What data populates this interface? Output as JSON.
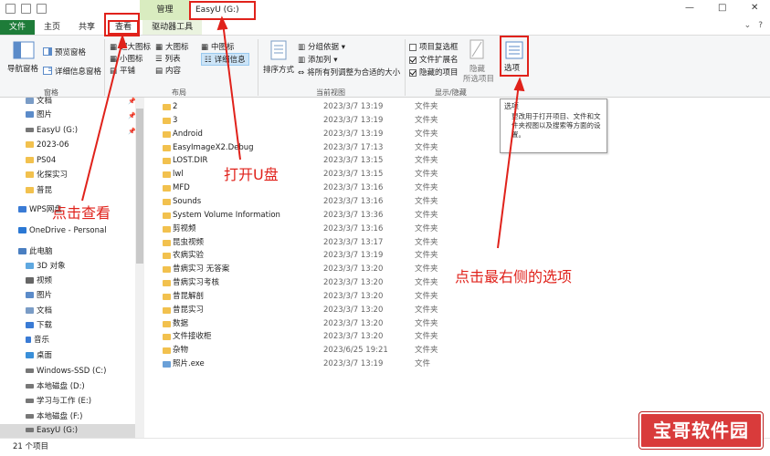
{
  "titlebar": {
    "context_tab": "管理",
    "window_title": "EasyU (G:)",
    "minimize": "—",
    "maximize": "□",
    "close": "✕"
  },
  "tabs": {
    "file": "文件",
    "home": "主页",
    "share": "共享",
    "view": "查看",
    "drive_tools": "驱动器工具",
    "help": "?"
  },
  "ribbon": {
    "nav_pane": "导航窗格",
    "preview_pane": "预览窗格",
    "details_pane": "详细信息窗格",
    "panes_group": "窗格",
    "extra_large_icons": "超大图标",
    "large_icons": "大图标",
    "medium_icons": "中图标",
    "small_icons": "小图标",
    "list": "列表",
    "details": "详细信息",
    "tiles": "平铺",
    "content": "内容",
    "layout_group": "布局",
    "sort_by": "排序方式",
    "group_by": "分组依据",
    "add_columns": "添加列",
    "size_columns": "将所有列调整为合适的大小",
    "current_view_group": "当前视图",
    "item_checkboxes": "项目复选框",
    "file_extensions": "文件扩展名",
    "hidden_items": "隐藏的项目",
    "hide_selected_1": "隐藏",
    "hide_selected_2": "所选项目",
    "options": "选项",
    "show_hide_group": "显示/隐藏"
  },
  "tooltip": {
    "title": "选项",
    "body": "更改用于打开项目、文件和文件夹视图以及搜索等方面的设置。"
  },
  "nav": [
    {
      "label": "文档",
      "pinned": true
    },
    {
      "label": "图片",
      "pinned": true
    },
    {
      "label": "EasyU (G:)",
      "pinned": true
    },
    {
      "label": "2023-06"
    },
    {
      "label": "PS04"
    },
    {
      "label": "化探实习"
    },
    {
      "label": "普昆"
    },
    {
      "label": "WPS网盘"
    },
    {
      "label": "OneDrive - Personal"
    },
    {
      "label": "此电脑"
    },
    {
      "label": "3D 对象"
    },
    {
      "label": "视频"
    },
    {
      "label": "图片"
    },
    {
      "label": "文档"
    },
    {
      "label": "下载"
    },
    {
      "label": "音乐"
    },
    {
      "label": "桌面"
    },
    {
      "label": "Windows-SSD (C:)"
    },
    {
      "label": "本地磁盘 (D:)"
    },
    {
      "label": "学习与工作 (E:)"
    },
    {
      "label": "本地磁盘 (F:)"
    },
    {
      "label": "EasyU (G:)"
    }
  ],
  "columns": {
    "name": "名称",
    "date": "修改日期",
    "type": "类型"
  },
  "files": [
    {
      "name": "2",
      "date": "2023/3/7 13:19",
      "type": "文件夹"
    },
    {
      "name": "3",
      "date": "2023/3/7 13:19",
      "type": "文件夹"
    },
    {
      "name": "Android",
      "date": "2023/3/7 13:19",
      "type": "文件夹"
    },
    {
      "name": "EasyImageX2.Debug",
      "date": "2023/3/7 17:13",
      "type": "文件夹"
    },
    {
      "name": "LOST.DIR",
      "date": "2023/3/7 13:15",
      "type": "文件夹"
    },
    {
      "name": "lwl",
      "date": "2023/3/7 13:15",
      "type": "文件夹"
    },
    {
      "name": "MFD",
      "date": "2023/3/7 13:16",
      "type": "文件夹"
    },
    {
      "name": "Sounds",
      "date": "2023/3/7 13:16",
      "type": "文件夹"
    },
    {
      "name": "System Volume Information",
      "date": "2023/3/7 13:36",
      "type": "文件夹"
    },
    {
      "name": "剪视频",
      "date": "2023/3/7 13:16",
      "type": "文件夹"
    },
    {
      "name": "昆虫视频",
      "date": "2023/3/7 13:17",
      "type": "文件夹"
    },
    {
      "name": "农病实验",
      "date": "2023/3/7 13:19",
      "type": "文件夹"
    },
    {
      "name": "昔病实习 无答案",
      "date": "2023/3/7 13:20",
      "type": "文件夹"
    },
    {
      "name": "昔病实习考核",
      "date": "2023/3/7 13:20",
      "type": "文件夹"
    },
    {
      "name": "昔昆解剖",
      "date": "2023/3/7 13:20",
      "type": "文件夹"
    },
    {
      "name": "昔昆实习",
      "date": "2023/3/7 13:20",
      "type": "文件夹"
    },
    {
      "name": "数据",
      "date": "2023/3/7 13:20",
      "type": "文件夹"
    },
    {
      "name": "文件接收柜",
      "date": "2023/3/7 13:20",
      "type": "文件夹"
    },
    {
      "name": "杂物",
      "date": "2023/6/25 19:21",
      "type": "文件夹"
    },
    {
      "name": "照片.exe",
      "date": "2023/3/7 13:19",
      "type": "文件"
    }
  ],
  "status": {
    "count": "21 个项目"
  },
  "annotations": {
    "click_view": "点击查看",
    "open_usb": "打开U盘",
    "click_options": "点击最右侧的选项"
  },
  "watermark": {
    "text": "宝哥软件园"
  },
  "colors": {
    "accent_red": "#e0221b",
    "file_tab_green": "#1e7c39",
    "folder_yellow": "#f2c14e"
  }
}
